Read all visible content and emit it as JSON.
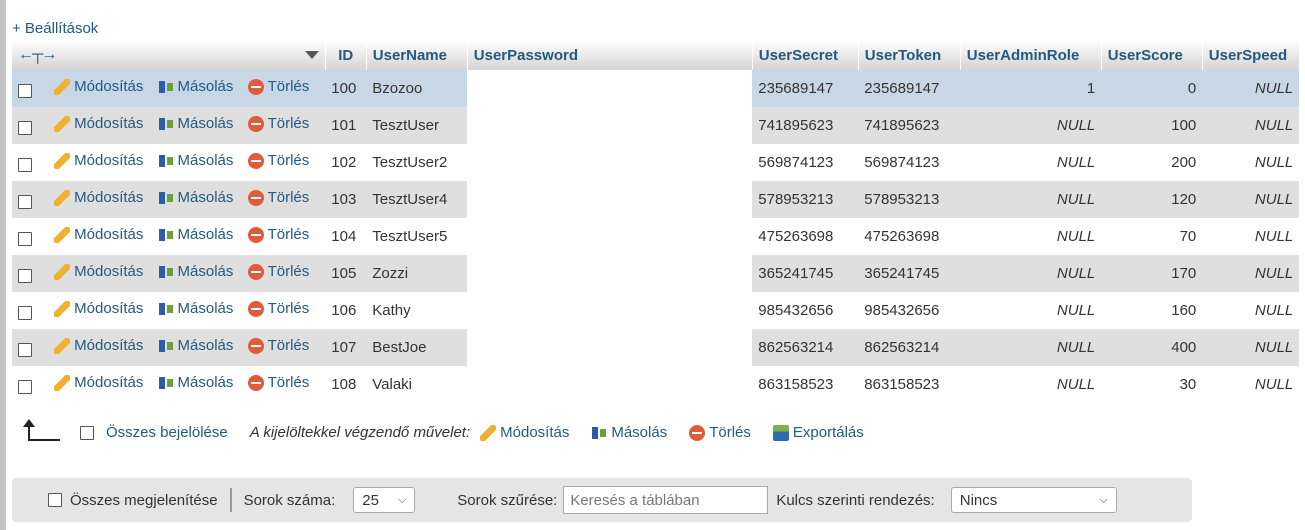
{
  "settings_link": "+ Beállítások",
  "columns": [
    "ID",
    "UserName",
    "UserPassword",
    "UserSecret",
    "UserToken",
    "UserAdminRole",
    "UserScore",
    "UserSpeed"
  ],
  "actions": {
    "edit": "Módosítás",
    "copy": "Másolás",
    "delete": "Törlés"
  },
  "rows": [
    {
      "id": "100",
      "name": "Bzozoo",
      "secret": "235689147",
      "token": "235689147",
      "admin": "1",
      "score": "0",
      "speed": "NULL"
    },
    {
      "id": "101",
      "name": "TesztUser",
      "secret": "741895623",
      "token": "741895623",
      "admin": "NULL",
      "score": "100",
      "speed": "NULL"
    },
    {
      "id": "102",
      "name": "TesztUser2",
      "secret": "569874123",
      "token": "569874123",
      "admin": "NULL",
      "score": "200",
      "speed": "NULL"
    },
    {
      "id": "103",
      "name": "TesztUser4",
      "secret": "578953213",
      "token": "578953213",
      "admin": "NULL",
      "score": "120",
      "speed": "NULL"
    },
    {
      "id": "104",
      "name": "TesztUser5",
      "secret": "475263698",
      "token": "475263698",
      "admin": "NULL",
      "score": "70",
      "speed": "NULL"
    },
    {
      "id": "105",
      "name": "Zozzi",
      "secret": "365241745",
      "token": "365241745",
      "admin": "NULL",
      "score": "170",
      "speed": "NULL"
    },
    {
      "id": "106",
      "name": "Kathy",
      "secret": "985432656",
      "token": "985432656",
      "admin": "NULL",
      "score": "160",
      "speed": "NULL"
    },
    {
      "id": "107",
      "name": "BestJoe",
      "secret": "862563214",
      "token": "862563214",
      "admin": "NULL",
      "score": "400",
      "speed": "NULL"
    },
    {
      "id": "108",
      "name": "Valaki",
      "secret": "863158523",
      "token": "863158523",
      "admin": "NULL",
      "score": "30",
      "speed": "NULL"
    }
  ],
  "bulk": {
    "select_all": "Összes bejelölése",
    "with_selected": "A kijelöltekkel végzendő művelet:",
    "edit": "Módosítás",
    "copy": "Másolás",
    "delete": "Törlés",
    "export": "Exportálás"
  },
  "nav": {
    "show_all": "Összes megjelenítése",
    "rows_label": "Sorok száma:",
    "rows_value": "25",
    "filter_label": "Sorok szűrése:",
    "filter_placeholder": "Keresés a táblában",
    "sort_label": "Kulcs szerinti rendezés:",
    "sort_value": "Nincs"
  }
}
